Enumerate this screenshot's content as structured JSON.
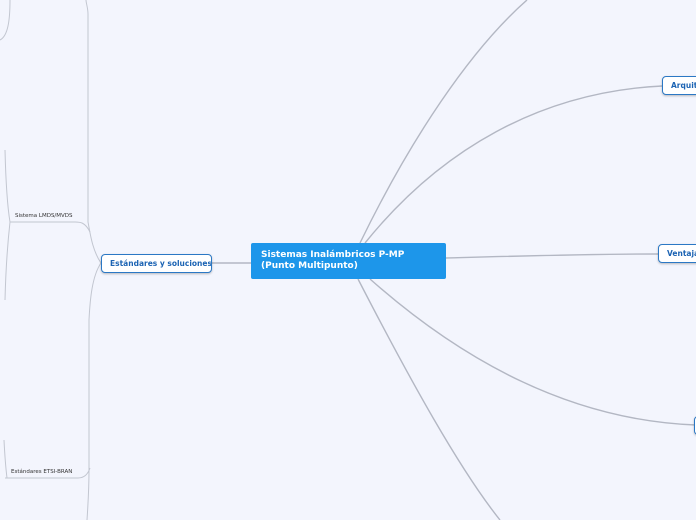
{
  "central": {
    "title": "Sistemas Inalámbricos P-MP (Punto Multipunto)"
  },
  "branches": {
    "left": "Estándares y soluciones",
    "right_1": "Arquitectura",
    "right_2": "Ventajas"
  },
  "subtopics": {
    "lmds": "Sistema LMDS/MVDS",
    "etsi": "Estándares ETSI-BRAN"
  },
  "colors": {
    "background": "#f3f5fd",
    "central_fill": "#1d96ea",
    "node_border": "#2b78c5",
    "connector": "#b3b7c3"
  }
}
